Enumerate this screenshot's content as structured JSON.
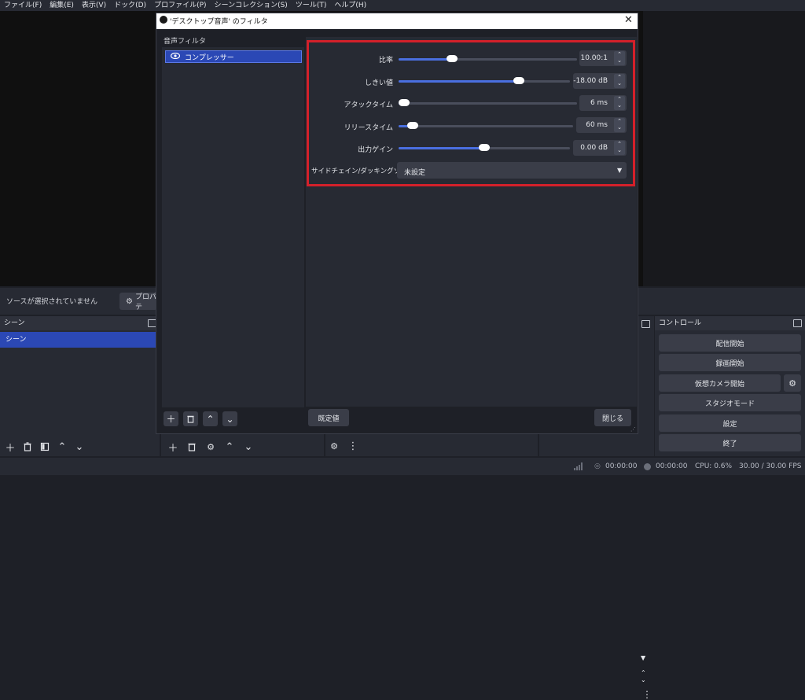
{
  "menu": [
    "ファイル(F)",
    "編集(E)",
    "表示(V)",
    "ドック(D)",
    "プロファイル(P)",
    "シーンコレクション(S)",
    "ツール(T)",
    "ヘルプ(H)"
  ],
  "source_bar": {
    "no_source": "ソースが選択されていません",
    "properties": "プロパテ"
  },
  "scenes": {
    "title": "シーン",
    "items": [
      "シーン"
    ]
  },
  "controls": {
    "title": "コントロール",
    "buttons": [
      "配信開始",
      "録画開始",
      "仮想カメラ開始",
      "スタジオモード",
      "設定",
      "終了"
    ]
  },
  "status": {
    "stream_time": "00:00:00",
    "rec_time": "00:00:00",
    "cpu": "CPU: 0.6%",
    "fps": "30.00 / 30.00 FPS"
  },
  "dialog": {
    "title": "'デスクトップ音声' のフィルタ",
    "audio_filters_label": "音声フィルタ",
    "filter_item": "コンプレッサー",
    "params": {
      "ratio": {
        "label": "比率",
        "value": "10.00:1",
        "fraction": 0.3
      },
      "threshold": {
        "label": "しきい値",
        "value": "-18.00 dB",
        "fraction": 0.7
      },
      "attack": {
        "label": "アタックタイム",
        "value": "6 ms",
        "fraction": 0.03
      },
      "release": {
        "label": "リリースタイム",
        "value": "60 ms",
        "fraction": 0.08
      },
      "output_gain": {
        "label": "出力ゲイン",
        "value": "0.00 dB",
        "fraction": 0.5
      }
    },
    "sidechain": {
      "label": "サイドチェイン/ダッキングソース",
      "value": "未設定"
    },
    "defaults_button": "既定値",
    "close_button": "閉じる"
  },
  "colors": {
    "accent": "#2b48b5",
    "highlight": "#d3202a",
    "slider_fill": "#4a6fe0"
  }
}
